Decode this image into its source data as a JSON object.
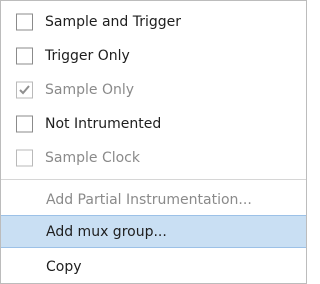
{
  "menu": {
    "items": [
      {
        "label": "Sample and Trigger",
        "checked": false,
        "enabled": true
      },
      {
        "label": "Trigger Only",
        "checked": false,
        "enabled": true
      },
      {
        "label": "Sample Only",
        "checked": true,
        "enabled": false
      },
      {
        "label": "Not Intrumented",
        "checked": false,
        "enabled": true
      },
      {
        "label": "Sample Clock",
        "checked": false,
        "enabled": false
      }
    ],
    "actions": [
      {
        "label": "Add Partial Instrumentation...",
        "enabled": false,
        "highlighted": false
      },
      {
        "label": "Add mux group...",
        "enabled": true,
        "highlighted": true
      },
      {
        "label": "Copy",
        "enabled": true,
        "highlighted": false
      }
    ]
  },
  "colors": {
    "highlight_background": "#c9dff3",
    "highlight_border": "#9cc1e7",
    "disabled_text": "#8a8a8a"
  }
}
